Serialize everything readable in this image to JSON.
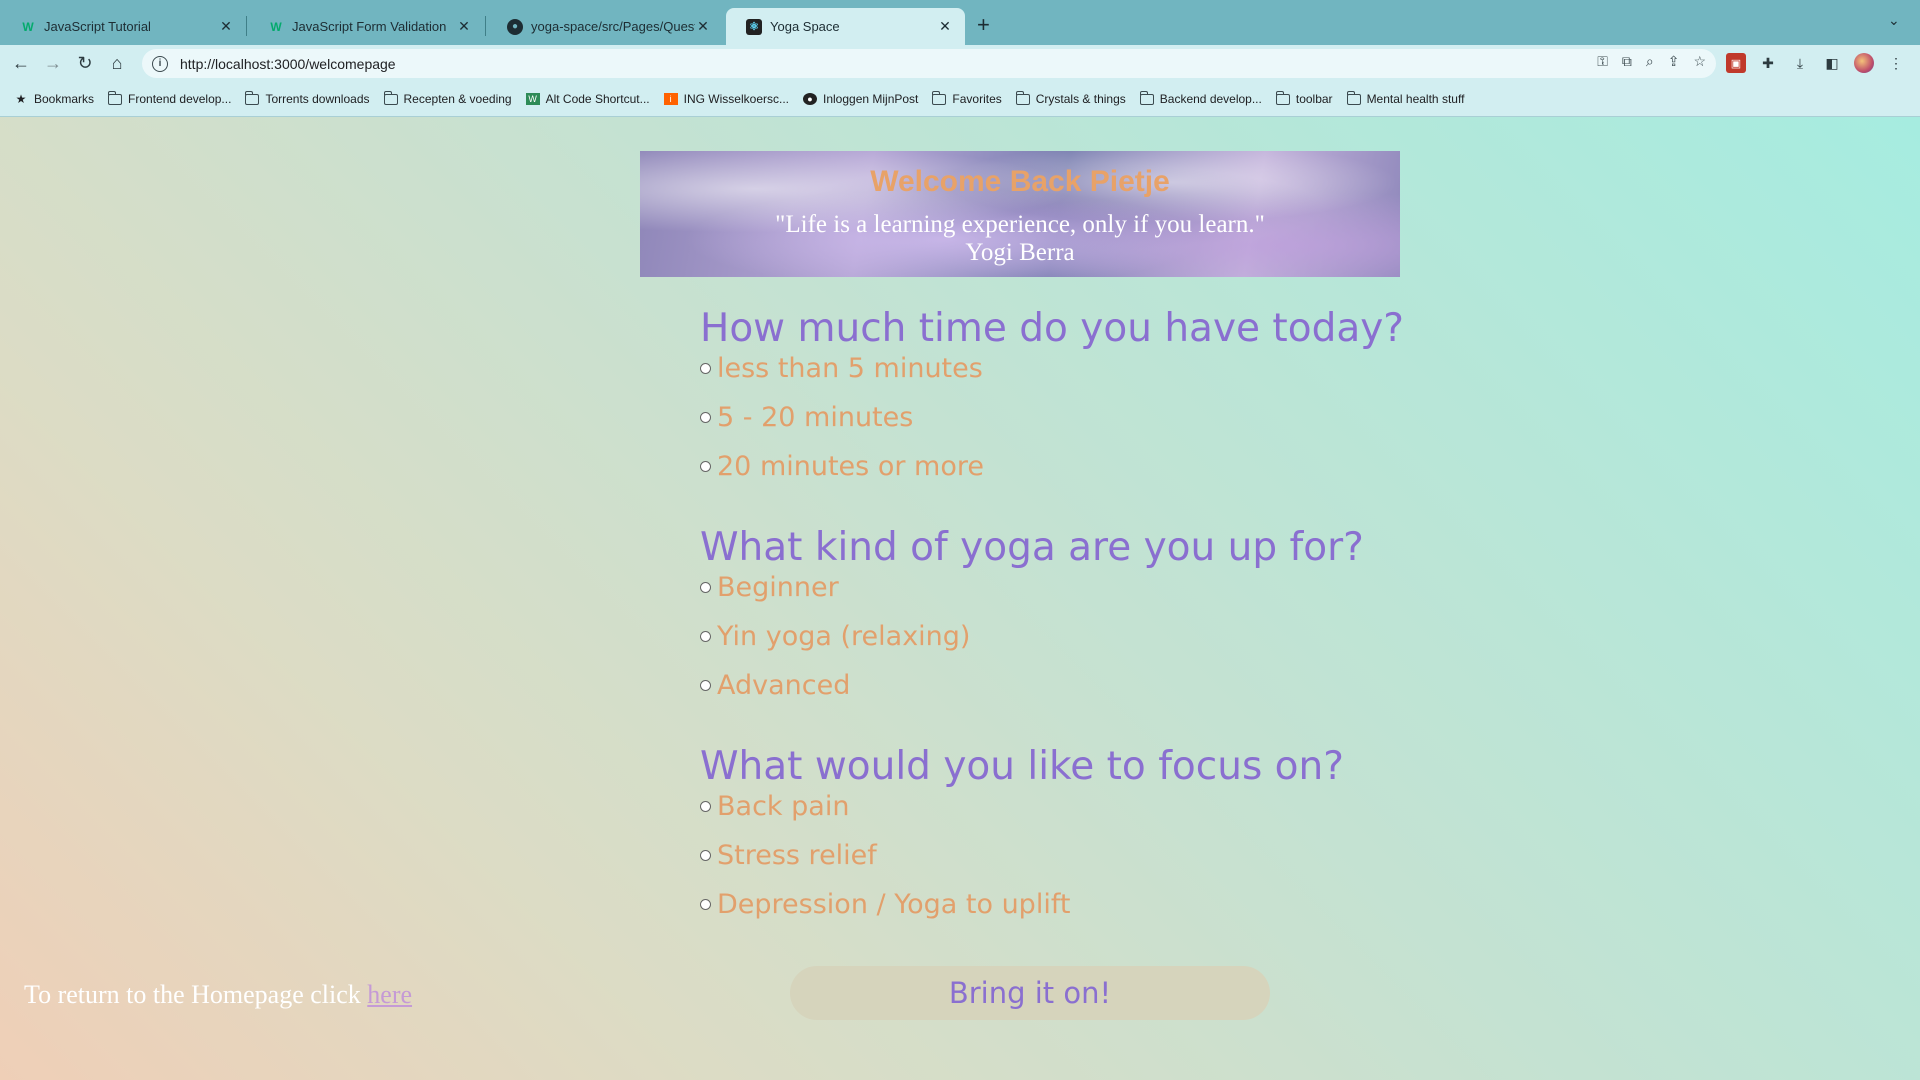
{
  "browser": {
    "tabs": [
      {
        "title": "JavaScript Tutorial",
        "favicon": "w3schools-icon",
        "active": false
      },
      {
        "title": "JavaScript Form Validation",
        "favicon": "w3schools-icon",
        "active": false
      },
      {
        "title": "yoga-space/src/Pages/Questic",
        "favicon": "github-icon",
        "active": false
      },
      {
        "title": "Yoga Space",
        "favicon": "react-icon",
        "active": true
      }
    ],
    "url": "http://localhost:3000/welcomepage",
    "bookmarks": [
      {
        "label": "Bookmarks",
        "icon": "star-icon"
      },
      {
        "label": "Frontend develop...",
        "icon": "folder-icon"
      },
      {
        "label": "Torrents downloads",
        "icon": "folder-icon"
      },
      {
        "label": "Recepten & voeding",
        "icon": "folder-icon"
      },
      {
        "label": "Alt Code Shortcut...",
        "icon": "altcode-icon"
      },
      {
        "label": "ING Wisselkoersc...",
        "icon": "ing-icon"
      },
      {
        "label": "Inloggen MijnPost",
        "icon": "postnl-icon"
      },
      {
        "label": "Favorites",
        "icon": "folder-icon"
      },
      {
        "label": "Crystals & things",
        "icon": "folder-icon"
      },
      {
        "label": "Backend develop...",
        "icon": "folder-icon"
      },
      {
        "label": "toolbar",
        "icon": "folder-icon"
      },
      {
        "label": "Mental health stuff",
        "icon": "folder-icon"
      }
    ]
  },
  "banner": {
    "title": "Welcome Back Pietje",
    "quote": "\"Life is a learning experience, only if you learn.\"",
    "author": "Yogi Berra"
  },
  "questions": [
    {
      "question": "How much time do you have today?",
      "options": [
        "less than 5 minutes",
        "5 - 20 minutes",
        "20 minutes or more"
      ]
    },
    {
      "question": "What kind of yoga are you up for?",
      "options": [
        "Beginner",
        "Yin yoga (relaxing)",
        "Advanced"
      ]
    },
    {
      "question": "What would you like to focus on?",
      "options": [
        "Back pain",
        "Stress relief",
        "Depression / Yoga to uplift"
      ]
    }
  ],
  "submit_label": "Bring it on!",
  "footer": {
    "text": "To return to the Homepage click ",
    "link": "here"
  },
  "colors": {
    "question": "#8a6fd0",
    "option": "#e2a06c",
    "chrome": "#71b5c0",
    "toolbar": "#d2eef1"
  }
}
